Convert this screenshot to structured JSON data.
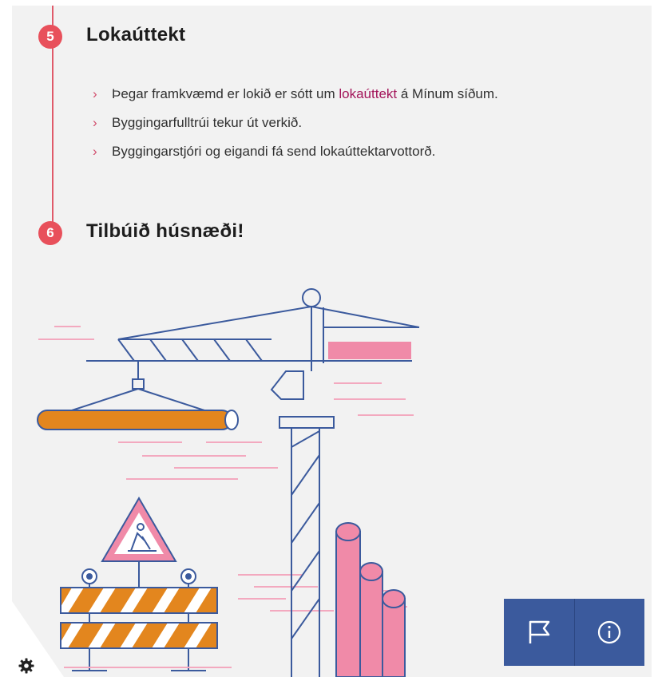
{
  "steps": [
    {
      "number": "5",
      "title": "Lokaúttekt",
      "bullets": [
        {
          "before": "Þegar framkvæmd er lokið er sótt um ",
          "link": "lokaúttekt",
          "after": " á Mínum síðum."
        },
        {
          "before": "Byggingarfulltrúi tekur út verkið.",
          "link": "",
          "after": ""
        },
        {
          "before": "Byggingarstjóri og eigandi fá send lokaúttektarvottorð.",
          "link": "",
          "after": ""
        }
      ]
    },
    {
      "number": "6",
      "title": "Tilbúið húsnæði!"
    }
  ],
  "icons": {
    "bullet": "chevron-right-icon",
    "flag": "flag-icon",
    "info": "info-icon",
    "settings": "gear-icon"
  },
  "colors": {
    "accent_red": "#e8505b",
    "link": "#a3155a",
    "action_bar": "#3b5a9d",
    "crane_blue": "#3b5a9d",
    "pink": "#f08aa8",
    "orange": "#e3861e"
  }
}
